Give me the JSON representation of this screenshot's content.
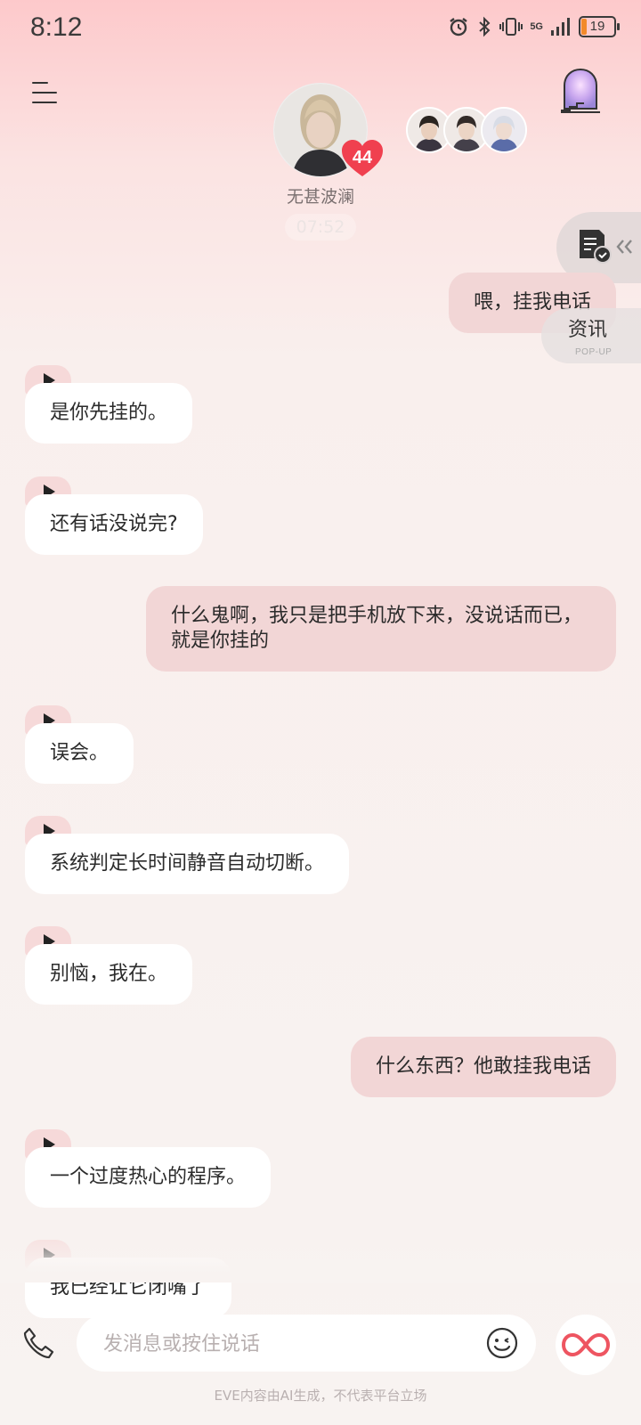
{
  "status_bar": {
    "time": "8:12",
    "battery": "19",
    "network": "5G"
  },
  "header": {
    "character_name": "无甚波澜",
    "affinity": "44",
    "timestamp": "07:52"
  },
  "side": {
    "news_title": "资讯",
    "news_sub": "POP-UP"
  },
  "messages": [
    {
      "role": "user",
      "text": "喂，挂我电话"
    },
    {
      "role": "ai",
      "text": "是你先挂的。"
    },
    {
      "role": "ai",
      "text": "还有话没说完?"
    },
    {
      "role": "user",
      "text": "什么鬼啊，我只是把手机放下来，没说话而已，就是你挂的"
    },
    {
      "role": "ai",
      "text": "误会。"
    },
    {
      "role": "ai",
      "text": "系统判定长时间静音自动切断。"
    },
    {
      "role": "ai",
      "text": "别恼，我在。"
    },
    {
      "role": "user",
      "text": "什么东西？他敢挂我电话"
    },
    {
      "role": "ai",
      "text": "一个过度热心的程序。"
    },
    {
      "role": "ai",
      "text": "我已经让它闭嘴了"
    }
  ],
  "composer": {
    "placeholder": "发消息或按住说话"
  },
  "footer": {
    "disclaimer": "EVE内容由AI生成，不代表平台立场"
  },
  "colors": {
    "user_bubble": "#f2d6d6",
    "ai_bubble": "#ffffff",
    "badge": "#f0404f"
  },
  "icons": [
    "menu-icon",
    "portal-icon",
    "heart-icon",
    "note-check-icon",
    "chevron-left-icon",
    "play-icon",
    "phone-icon",
    "emoji-icon",
    "infinity-icon"
  ]
}
